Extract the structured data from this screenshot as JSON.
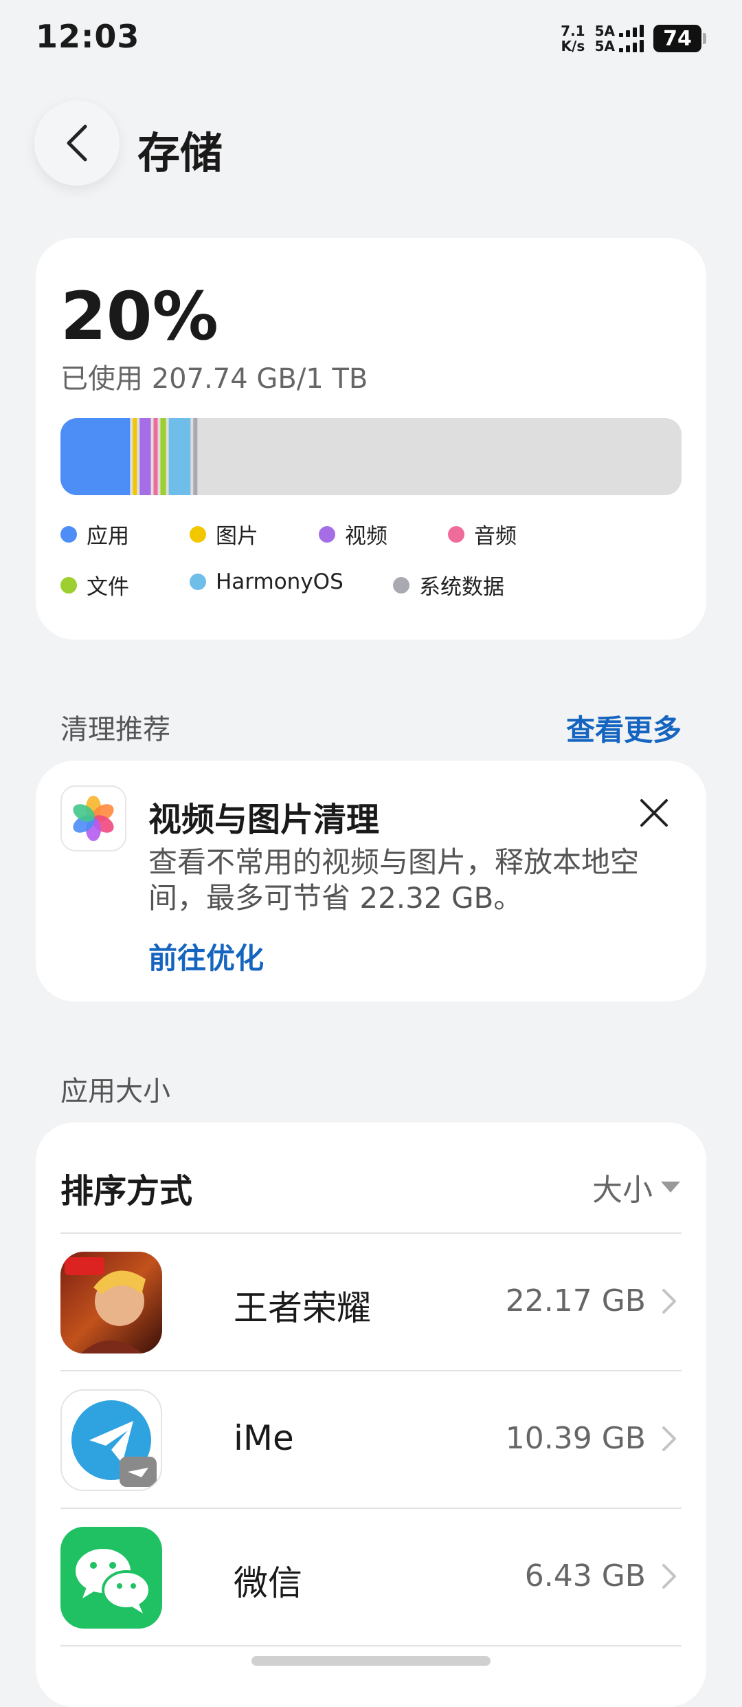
{
  "status_bar": {
    "time": "12:03",
    "net_speed_value": "7.1",
    "net_speed_unit": "K/s",
    "sim1": "5A",
    "sim2": "5A",
    "battery": "74"
  },
  "header": {
    "title": "存储"
  },
  "usage": {
    "percent": "20%",
    "used_text": "已使用 207.74 GB/1 TB",
    "segments": [
      {
        "name": "应用",
        "color": "#4d8df6",
        "fraction": 0.112
      },
      {
        "name": "图片",
        "color": "#f2c700",
        "fraction": 0.006
      },
      {
        "name": "视频",
        "color": "#a66ee6",
        "fraction": 0.018
      },
      {
        "name": "音频",
        "color": "#ef6b9a",
        "fraction": 0.004
      },
      {
        "name": "文件",
        "color": "#9ccf2f",
        "fraction": 0.009
      },
      {
        "name": "HarmonyOS",
        "color": "#6fbde9",
        "fraction": 0.035
      },
      {
        "name": "系统数据",
        "color": "#a9a9b1",
        "fraction": 0.006
      }
    ],
    "legend": [
      {
        "label": "应用",
        "color": "#4d8df6"
      },
      {
        "label": "图片",
        "color": "#f2c700"
      },
      {
        "label": "视频",
        "color": "#a66ee6"
      },
      {
        "label": "音频",
        "color": "#ef6b9a"
      },
      {
        "label": "文件",
        "color": "#9ccf2f"
      },
      {
        "label": "HarmonyOS",
        "color": "#6fbde9"
      },
      {
        "label": "系统数据",
        "color": "#a9a9b1"
      }
    ]
  },
  "cleanup": {
    "section_label": "清理推荐",
    "see_more": "查看更多",
    "card_title": "视频与图片清理",
    "card_desc": "查看不常用的视频与图片，释放本地空间，最多可节省 22.32 GB。",
    "card_link": "前往优化"
  },
  "apps": {
    "section_label": "应用大小",
    "sort_label": "排序方式",
    "sort_value": "大小",
    "items": [
      {
        "name": "王者荣耀",
        "size": "22.17 GB",
        "icon": "game-icon"
      },
      {
        "name": "iMe",
        "size": "10.39 GB",
        "icon": "ime-icon"
      },
      {
        "name": "微信",
        "size": "6.43 GB",
        "icon": "wechat-icon"
      }
    ]
  }
}
